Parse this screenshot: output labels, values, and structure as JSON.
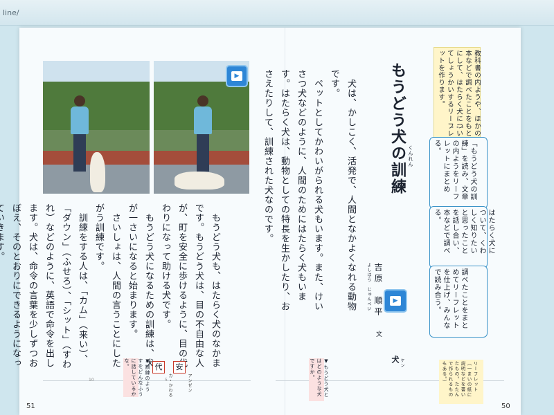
{
  "browser": {
    "url_fragment": "line/"
  },
  "left_page": {
    "paragraphs": [
      "　もうどう犬も、はたらく犬のなかまです。もうどう犬は、目の不自由な人が、町を安全に歩けるように、目の代わりになって助ける犬です。",
      "　もうどう犬になるための訓練は、犬が一さいになると始まります。",
      "　さいしょは、人間の言うことにしたがう訓練です。",
      "　訓練をする人は、「カム」（来い）、「ダウン」（ふせろ）、「シット」（すわれ）などのように、英語で命令を出します。犬は、命令の言葉を少しずつおぼえ、そのとおりにできるようになっていきます。"
    ],
    "page_number": "51",
    "tick_numbers": [
      "10",
      "5"
    ],
    "kanji_boxes": [
      "代",
      "安"
    ],
    "side_notes": [
      "アンゼン",
      "カ・かわる",
      "カ・シム",
      "ダイ"
    ],
    "pink_note": "▼訓練のようすをどんなふうに話しているかな。"
  },
  "right_page": {
    "title": "もうどう犬の訓練",
    "title_ruby": "くんれん",
    "author_family": "吉原",
    "author_given": "順平",
    "author_suffix": "文",
    "author_ruby": "よしはら　じゅんぺい",
    "paragraphs": [
      "　犬は、かしこく、活発で、人間となかよくなれる動物です。",
      "　ペットとしてかわいがられる犬もいます。また、けいさつ犬などのように、人間のためにはたらく犬もいます。はたらく犬は、動物としての特長を生かしたり、おさえたりして、訓練された犬なのです。"
    ],
    "intro_note": "教科書の内ようや、ほかの本などで調べたことをもとにして、はたらく犬についてしょうかいするリーフレットを作ります。",
    "steps": [
      "「もうどう犬の訓練」を読み、文章の内ようをリーフレットにまとめる。",
      "はたらく犬について、くわしく知りたいと思ったことを話し合い、本などで調べる。",
      "調べたことをまとめてリーフレットを仕上げ、みんなで読み合う。"
    ],
    "footer_note": "▼もうどう犬とはどのような犬ですか。",
    "footer_kanji": "犬",
    "footer_kanji_reading": "ケン",
    "glossary": "リーフレット（一まいの紙に説明などを書いたもの。たたんで作られるものもある。）",
    "page_number": "50"
  },
  "icons": [
    "play-video-icon",
    "play-audio-icon"
  ]
}
